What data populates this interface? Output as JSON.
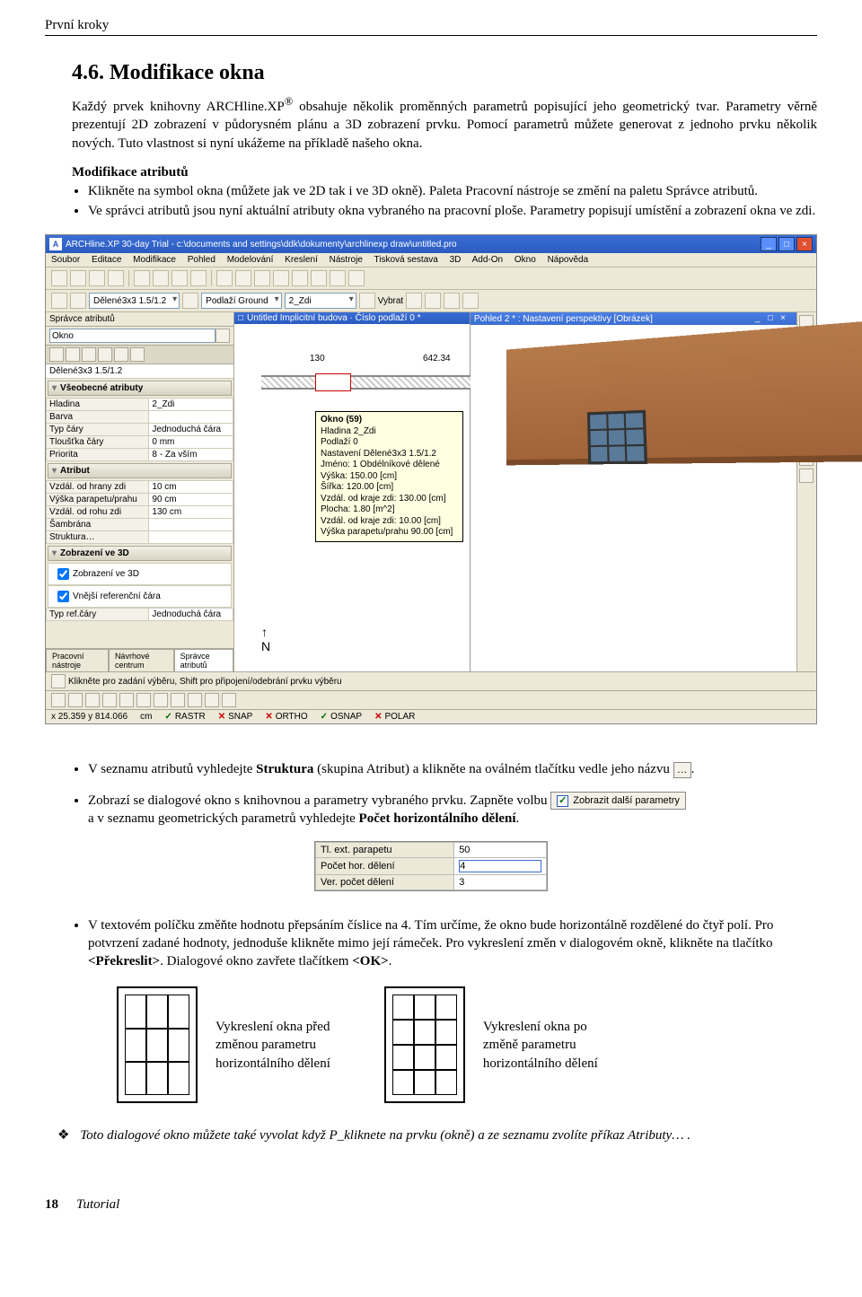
{
  "page_header": "První kroky",
  "section_number_title": "4.6. Modifikace okna",
  "para1_a": "Každý prvek knihovny ARCHline.XP",
  "para1_reg": "®",
  "para1_b": " obsahuje několik proměnných parametrů popisující jeho geometrický tvar. Parametry věrně prezentují 2D zobrazení v půdorysném plánu a 3D zobrazení prvku. Pomocí parametrů můžete generovat z jednoho prvku několik nových. Tuto vlastnost si nyní ukážeme na příkladě našeho okna.",
  "subhead1": "Modifikace atributů",
  "bullet1": "Klikněte na symbol okna (můžete jak ve 2D tak i ve 3D okně). Paleta Pracovní nástroje se změní na paletu Správce atributů.",
  "bullet2": "Ve správci atributů jsou nyní aktuální atributy okna vybraného na pracovní ploše. Parametry popisují umístění a zobrazení okna ve zdi.",
  "app": {
    "title": "ARCHline.XP 30-day Trial - c:\\documents and settings\\ddk\\dokumenty\\archlinexp draw\\untitled.pro",
    "menus": [
      "Soubor",
      "Editace",
      "Modifikace",
      "Pohled",
      "Modelování",
      "Kreslení",
      "Nástroje",
      "Tisková sestava",
      "3D",
      "Add-On",
      "Okno",
      "Nápověda"
    ],
    "combo_scale": "Dělené3x3 1.5/1.2",
    "combo_ground": "Podlaží Ground",
    "combo_zdi": "2_Zdi",
    "btn_vybrat": "Vybrat",
    "left": {
      "panel_title": "Správce atributů",
      "type_input": "Okno",
      "item_name": "Dělené3x3 1.5/1.2",
      "sec_general": "Všeobecné atributy",
      "rows_general": [
        [
          "Hladina",
          "2_Zdi"
        ],
        [
          "Barva",
          ""
        ],
        [
          "Typ čáry",
          "Jednoduchá čára"
        ],
        [
          "Tloušťka čáry",
          "0 mm"
        ],
        [
          "Priorita",
          "8 - Za vším"
        ]
      ],
      "sec_attr": "Atribut",
      "rows_attr": [
        [
          "Vzdál. od hrany zdi",
          "10 cm"
        ],
        [
          "Výška parapetu/prahu",
          "90 cm"
        ],
        [
          "Vzdál. od rohu zdi",
          "130 cm"
        ],
        [
          "Šambrána",
          ""
        ],
        [
          "Struktura…",
          ""
        ]
      ],
      "sec_3d": "Zobrazení ve 3D",
      "chk_3d": "Zobrazení ve 3D",
      "chk_ref": "Vnější referenční čára",
      "row_refline": [
        "Typ ref.čáry",
        "Jednoduchá čára"
      ],
      "tabs": [
        "Pracovní nástroje",
        "Návrhové centrum",
        "Správce atributů"
      ]
    },
    "view2d": {
      "title": "Untitled Implicitní budova · Číslo podlaží 0 *",
      "dim1": "130",
      "dim2": "642.34",
      "tooltip_title": "Okno (59)",
      "tooltip_lines": [
        "Hladina 2_Zdi",
        "Podlaží 0",
        "Nastavení Dělené3x3 1.5/1.2",
        "Jméno: 1 Obdélníkové dělené",
        "Výška:  150.00 [cm]",
        "Šířka:  120.00  [cm]",
        "Vzdál. od kraje zdi:  130.00 [cm]",
        "Plocha:     1.80 [m^2]",
        "Vzdál. od kraje zdi:   10.00 [cm]",
        "Výška parapetu/prahu  90.00 [cm]"
      ],
      "compass": "N"
    },
    "view3d": {
      "title": "Pohled 2 *  : Nastavení perspektivy [Obrázek]"
    },
    "status_hint": "Klikněte pro zadání výběru, Shift pro připojení/odebrání prvku výběru",
    "status2": {
      "coords": "x  25.359  y  814.066",
      "unit": "cm",
      "items": [
        {
          "on": true,
          "label": "RASTR"
        },
        {
          "on": false,
          "label": "SNAP"
        },
        {
          "on": false,
          "label": "ORTHO"
        },
        {
          "on": true,
          "label": "OSNAP"
        },
        {
          "on": false,
          "label": "POLAR"
        }
      ]
    }
  },
  "bullet3_a": "V seznamu atributů vyhledejte ",
  "bullet3_b": "Struktura",
  "bullet3_c": " (skupina Atribut) a klikněte na oválném tlačítku vedle jeho názvu ",
  "bullet3_btn": "…",
  "bullet3_d": ".",
  "bullet4_a": "Zobrazí se dialogové okno s knihovnou a parametry vybraného prvku. Zapněte volbu ",
  "bullet4_chk": "Zobrazit další parametry",
  "bullet4_b": " a v seznamu geometrických parametrů vyhledejte ",
  "bullet4_c": "Počet horizontálního dělení",
  "bullet4_d": ".",
  "param_table": [
    [
      "Tl. ext. parapetu",
      "50"
    ],
    [
      "Počet hor. dělení",
      "4"
    ],
    [
      "Ver. počet dělení",
      "3"
    ]
  ],
  "param_active_row": 1,
  "bullet5_a": "V textovém políčku změňte hodnotu přepsáním číslice na 4. Tím určíme, že okno bude horizontálně rozdělené do čtyř polí. Pro potvrzení zadané hodnoty, jednoduše klikněte mimo její rámeček. Pro vykreslení změn v dialogovém okně, klikněte na tlačítko ",
  "bullet5_b": "<Překreslit>",
  "bullet5_c": ". Dialogové okno zavřete tlačítkem ",
  "bullet5_d": "<OK>",
  "bullet5_e": ".",
  "fig1_caption_l1": "Vykreslení okna před",
  "fig1_caption_l2": "změnou parametru",
  "fig1_caption_l3": "horizontálního dělení",
  "fig2_caption_l1": "Vykreslení okna po",
  "fig2_caption_l2": "změně parametru",
  "fig2_caption_l3": "horizontálního dělení",
  "note": "Toto dialogové okno můžete také vyvolat když P_kliknete na prvku (okně) a ze seznamu zvolíte příkaz Atributy… .",
  "footer_page": "18",
  "footer_text": "Tutorial"
}
